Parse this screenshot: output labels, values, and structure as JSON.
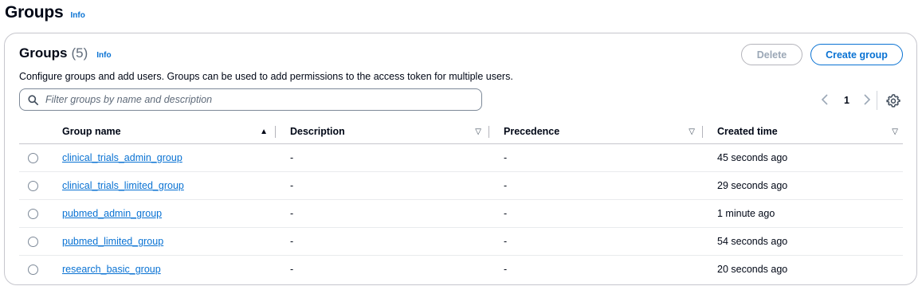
{
  "page": {
    "title": "Groups",
    "info_label": "Info"
  },
  "container": {
    "title": "Groups",
    "count": "(5)",
    "info_label": "Info",
    "description": "Configure groups and add users. Groups can be used to add permissions to the access token for multiple users.",
    "delete_label": "Delete",
    "create_label": "Create group"
  },
  "search": {
    "placeholder": "Filter groups by name and description",
    "value": ""
  },
  "pagination": {
    "current_page": "1",
    "prev_icon": "chevron-left-icon",
    "next_icon": "chevron-right-icon"
  },
  "table": {
    "columns": [
      "Group name",
      "Description",
      "Precedence",
      "Created time"
    ],
    "rows": [
      {
        "name": "clinical_trials_admin_group",
        "description": "-",
        "precedence": "-",
        "created": "45 seconds ago"
      },
      {
        "name": "clinical_trials_limited_group",
        "description": "-",
        "precedence": "-",
        "created": "29 seconds ago"
      },
      {
        "name": "pubmed_admin_group",
        "description": "-",
        "precedence": "-",
        "created": "1 minute ago"
      },
      {
        "name": "pubmed_limited_group",
        "description": "-",
        "precedence": "-",
        "created": "54 seconds ago"
      },
      {
        "name": "research_basic_group",
        "description": "-",
        "precedence": "-",
        "created": "20 seconds ago"
      }
    ]
  },
  "colors": {
    "link": "#0972d3",
    "text": "#000716",
    "border": "#c6c6cd",
    "muted": "#9ba7b6"
  }
}
